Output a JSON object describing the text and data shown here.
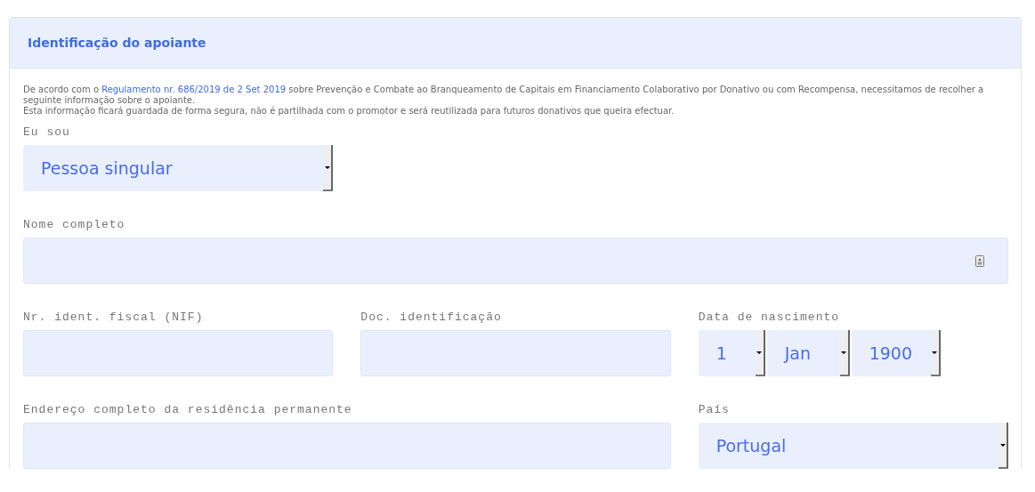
{
  "card": {
    "title": "Identificação do apoiante"
  },
  "notice": {
    "before": "De acordo com o ",
    "link": "Regulamento nr. 686/2019 de 2 Set 2019",
    "after": " sobre Prevenção e Combate ao Branqueamento de Capitais em Financiamento Colaborativo por Donativo ou com Recompensa, necessitamos de recolher a seguinte informação sobre o apoiante.",
    "second_line": "Esta informação ficará guardada de forma segura, não é partilhada com o promotor e será reutilizada para futuros donativos que queira efectuar."
  },
  "rows": [
    [
      {
        "kind": "select",
        "label": "Eu sou",
        "value": "Pessoa singular"
      }
    ],
    [
      {
        "kind": "text",
        "label": "Nome completo",
        "contact_icon": true
      }
    ],
    [
      {
        "kind": "text",
        "label": "Nr. ident. fiscal (NIF)"
      },
      {
        "kind": "text",
        "label": "Doc. identificação"
      },
      {
        "kind": "date",
        "label": "Data de nascimento",
        "parts": [
          "1",
          "Jan",
          "1900"
        ]
      }
    ],
    [
      {
        "kind": "text",
        "label": "Endereço completo da residência permanente"
      },
      {
        "kind": "select",
        "label": "País",
        "value": "Portugal"
      }
    ]
  ]
}
